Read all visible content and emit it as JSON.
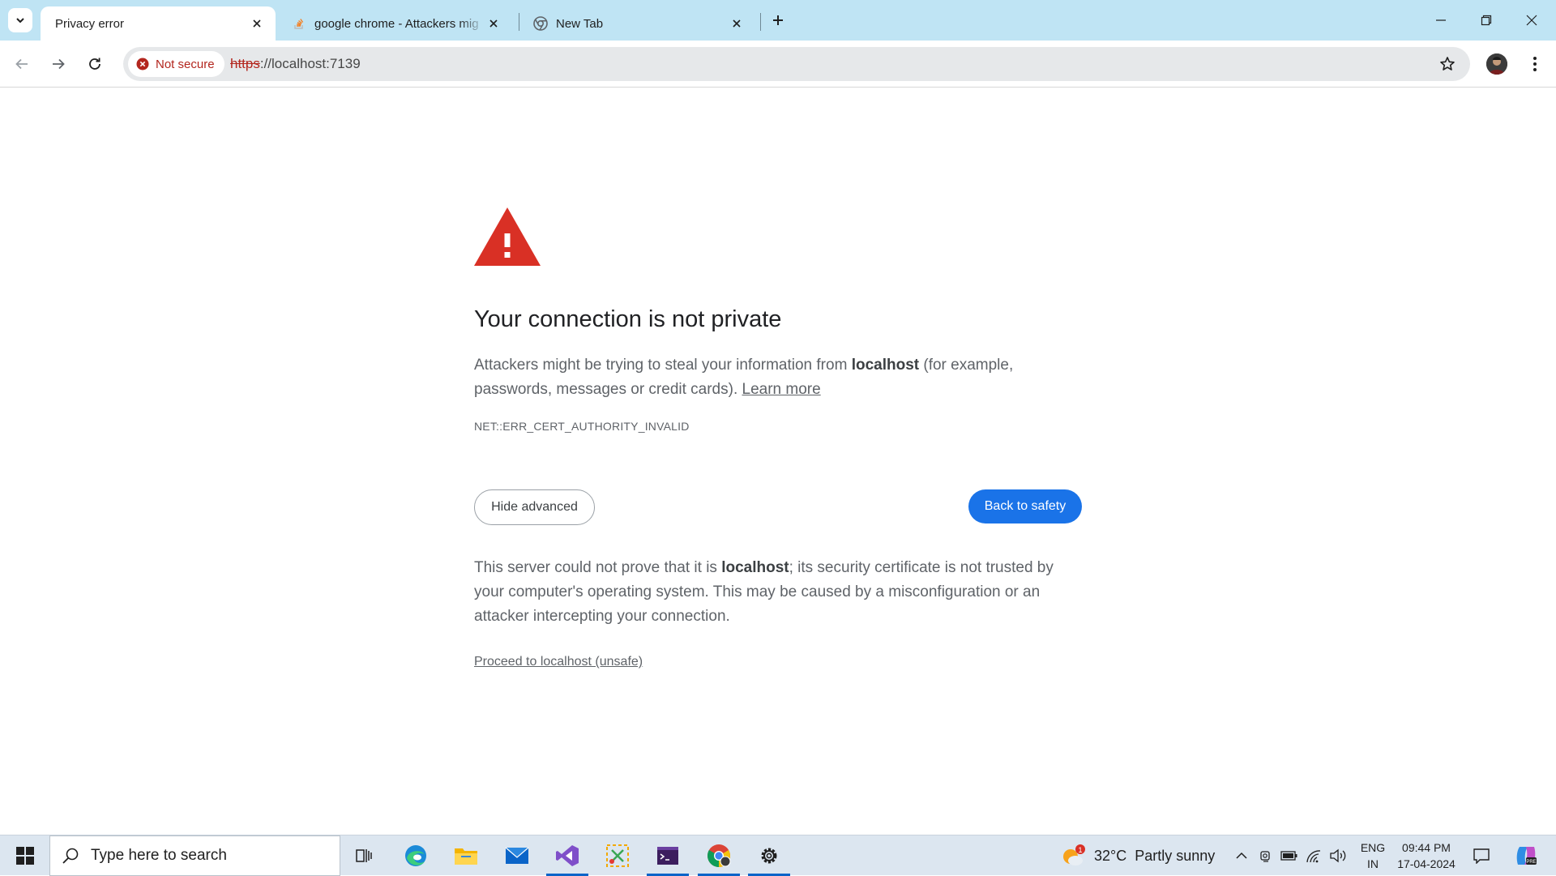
{
  "browser": {
    "tabs": [
      {
        "title": "Privacy error",
        "active": true,
        "icon": "none"
      },
      {
        "title": "google chrome - Attackers mig",
        "active": false,
        "icon": "stackoverflow-icon"
      },
      {
        "title": "New Tab",
        "active": false,
        "icon": "chrome-icon"
      }
    ],
    "accent_color": "#bfe4f4"
  },
  "toolbar": {
    "security_chip": "Not secure",
    "url_scheme": "https",
    "url_rest": "://localhost:7139"
  },
  "page": {
    "heading": "Your connection is not private",
    "explain_1": "Attackers might be trying to steal your information from ",
    "explain_host": "localhost",
    "explain_2": " (for example, passwords, messages or credit cards). ",
    "learn_more": "Learn more",
    "error_code": "NET::ERR_CERT_AUTHORITY_INVALID",
    "hide_advanced": "Hide advanced",
    "back_to_safety": "Back to safety",
    "details_1": "This server could not prove that it is ",
    "details_host": "localhost",
    "details_2": "; its security certificate is not trusted by your computer's operating system. This may be caused by a misconfiguration or an attacker intercepting your connection.",
    "proceed": "Proceed to localhost (unsafe)",
    "warning_color": "#d93025",
    "button_color": "#1a73e8"
  },
  "taskbar": {
    "search_placeholder": "Type here to search",
    "apps": [
      "task-view-icon",
      "edge-icon",
      "file-explorer-icon",
      "mail-icon",
      "visual-studio-icon",
      "snipping-icon",
      "terminal-icon",
      "chrome-icon",
      "settings-icon"
    ],
    "weather_badge": "1",
    "weather_temp": "32°C",
    "weather_desc": "Partly sunny",
    "lang_1": "ENG",
    "lang_2": "IN",
    "time": "09:44 PM",
    "date": "17-04-2024"
  }
}
